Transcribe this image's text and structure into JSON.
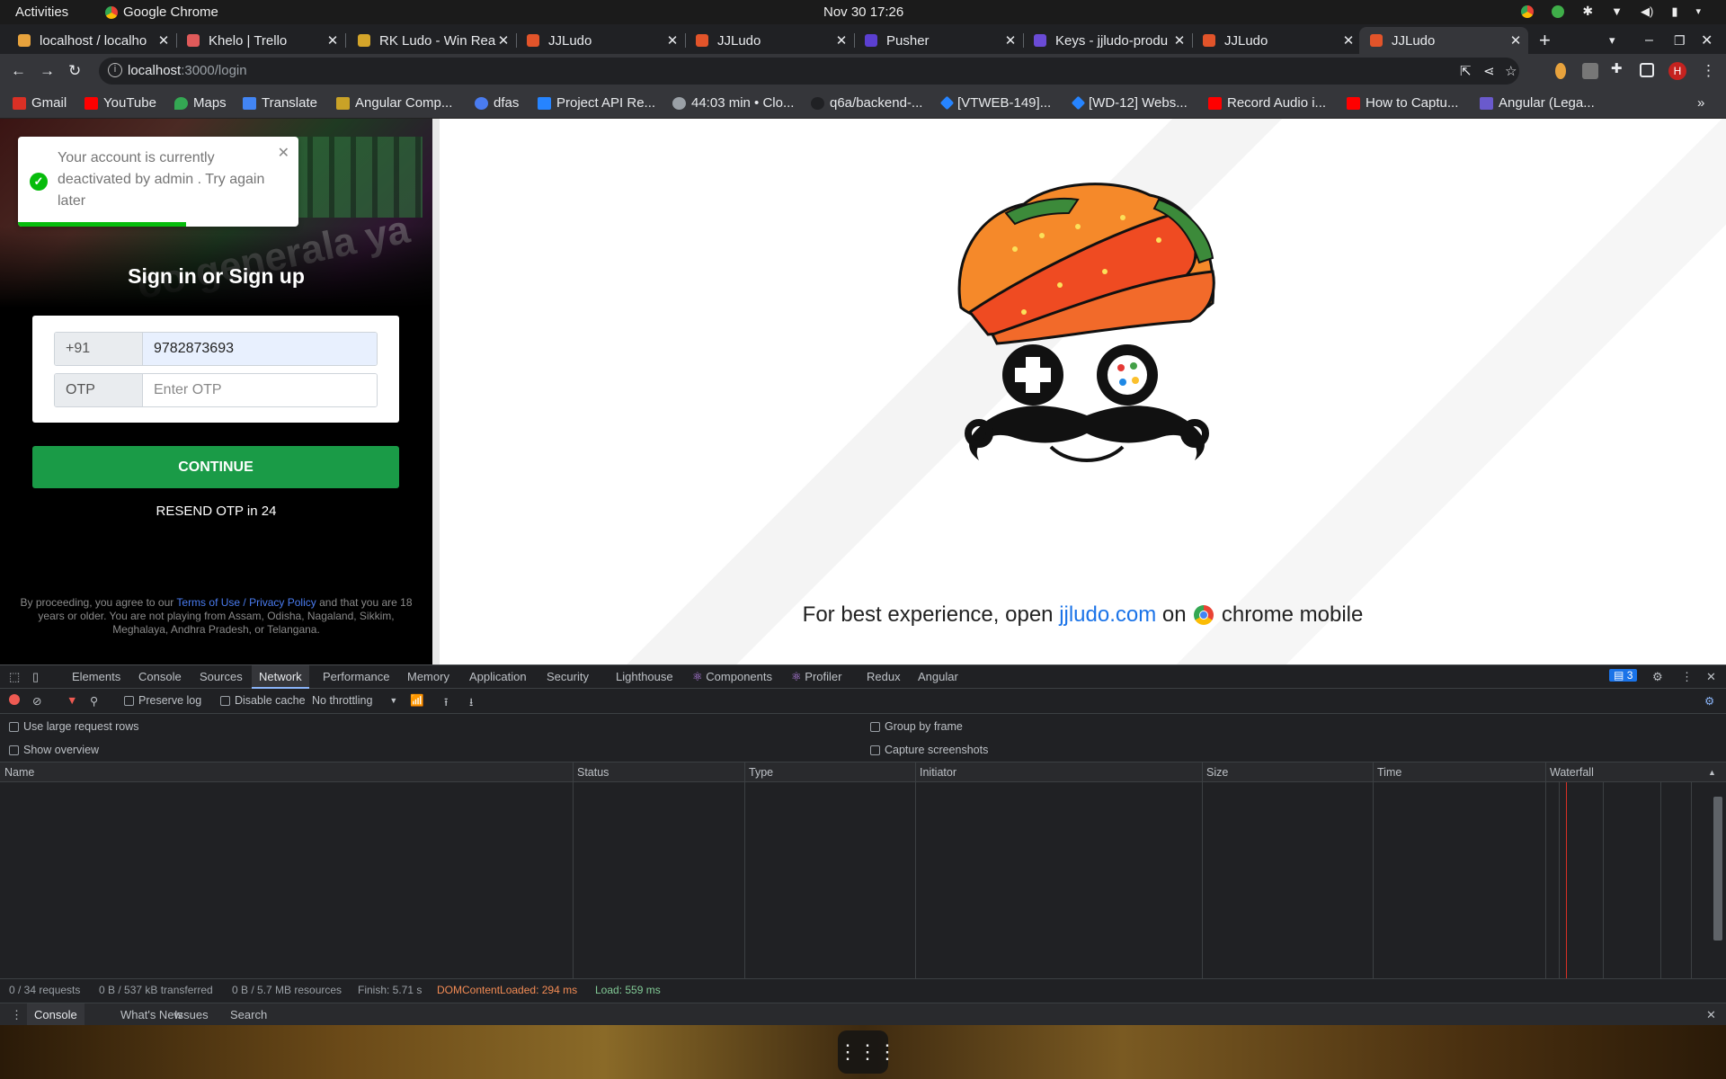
{
  "system": {
    "activities": "Activities",
    "app_name": "Google Chrome",
    "clock": "Nov 30  17:26"
  },
  "browser": {
    "tabs": [
      {
        "title": "localhost / localho",
        "fav_color": "#e8a33d"
      },
      {
        "title": "Khelo | Trello",
        "fav_color": "#e05a5a"
      },
      {
        "title": "RK Ludo - Win Rea",
        "fav_color": "#d4a52a"
      },
      {
        "title": "JJLudo",
        "fav_color": "#e2542a"
      },
      {
        "title": "JJLudo",
        "fav_color": "#e2542a"
      },
      {
        "title": "Pusher",
        "fav_color": "#5b3fd1"
      },
      {
        "title": "Keys - jjludo-produ",
        "fav_color": "#6a4bd6"
      },
      {
        "title": "JJLudo",
        "fav_color": "#e2542a"
      },
      {
        "title": "JJLudo",
        "fav_color": "#e2542a",
        "active": true
      }
    ],
    "url_host": "localhost",
    "url_path": ":3000/login",
    "profile_initial": "H",
    "bookmarks": [
      {
        "label": "Gmail",
        "color": "#d93025"
      },
      {
        "label": "YouTube",
        "color": "#ff0000"
      },
      {
        "label": "Maps",
        "color": "#34a853"
      },
      {
        "label": "Translate",
        "color": "#4285f4"
      },
      {
        "label": "Angular Comp...",
        "color": "#c9a227"
      },
      {
        "label": "dfas",
        "color": "#4a7cf0"
      },
      {
        "label": "Project API Re...",
        "color": "#2684ff"
      },
      {
        "label": "44:03 min • Clo...",
        "color": "#9aa0a6"
      },
      {
        "label": "q6a/backend-...",
        "color": "#202124"
      },
      {
        "label": "[VTWEB-149]...",
        "color": "#2684ff"
      },
      {
        "label": "[WD-12] Webs...",
        "color": "#2684ff"
      },
      {
        "label": "Record Audio i...",
        "color": "#ff0000"
      },
      {
        "label": "How to Captu...",
        "color": "#ff0000"
      },
      {
        "label": "Angular (Lega...",
        "color": "#6a5acd"
      }
    ]
  },
  "page": {
    "toast_message": "Your account is currently deactivated by admin . Try again later",
    "toast_progress": 0.6,
    "title": "Sign in or Sign up",
    "phone_prefix": "+91",
    "phone_value": "9782873693",
    "otp_label": "OTP",
    "otp_placeholder": "Enter OTP",
    "continue_label": "CONTINUE",
    "resend_text": "RESEND OTP in 24",
    "terms_prefix": "By proceeding, you agree to our ",
    "terms_link": "Terms of Use / Privacy Policy",
    "terms_suffix": " and that you are 18 years or older. You are not playing from Assam, Odisha, Nagaland, Sikkim, Meghalaya, Andhra Pradesh, or Telangana.",
    "banner_text": "oo generala ya",
    "tagline_before": "For best experience, open ",
    "tagline_link": "jjludo.com",
    "tagline_middle": " on ",
    "tagline_after": " chrome mobile"
  },
  "devtools": {
    "tabs": [
      "Elements",
      "Console",
      "Sources",
      "Network",
      "Performance",
      "Memory",
      "Application",
      "Security",
      "Lighthouse",
      "Components",
      "Profiler",
      "Redux",
      "Angular"
    ],
    "active_tab": "Network",
    "issues_count": "3",
    "toolbar": {
      "preserve_log": "Preserve log",
      "disable_cache": "Disable cache",
      "throttling": "No throttling"
    },
    "options": {
      "large_rows": "Use large request rows",
      "show_overview": "Show overview",
      "group_by_frame": "Group by frame",
      "capture_screenshots": "Capture screenshots"
    },
    "columns": [
      "Name",
      "Status",
      "Type",
      "Initiator",
      "Size",
      "Time",
      "Waterfall"
    ],
    "status": {
      "requests": "0 / 34 requests",
      "transferred": "0 B / 537 kB transferred",
      "resources": "0 B / 5.7 MB resources",
      "finish": "Finish: 5.71 s",
      "dcl": "DOMContentLoaded: 294 ms",
      "load": "Load: 559 ms"
    },
    "drawer_tabs": [
      "Console",
      "What's New",
      "Issues",
      "Search"
    ]
  }
}
